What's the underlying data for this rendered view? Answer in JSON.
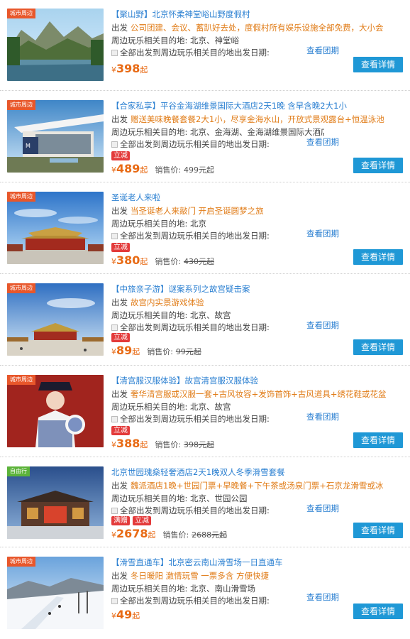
{
  "items": [
    {
      "badge": "城市周边",
      "title": "【聚山野】北京怀柔神堂峪山野度假村",
      "line2_label": "出发",
      "line2_text": "公司团建、会议、蓄趴好去处，度假村所有娱乐设施全部免费，大小会",
      "destinations": "周边玩乐相关目的地: 北京、神堂峪",
      "departure": "全部出发到周边玩乐相关目的地出发日期:",
      "view_group": "查看团期",
      "tags": [],
      "price": "398",
      "yen": "¥",
      "qi": "起",
      "orig_label": "",
      "orig_price": "",
      "detail_button": "查看详情"
    },
    {
      "badge": "城市周边",
      "title": "【合家私享】平谷金海湖维景国际大酒店2天1晚 含早含晚2大1小",
      "line2_label": "出发",
      "line2_text": "赠送美味晚餐套餐2大1小，尽享金海水山，开放式景观露台+恒温泳池",
      "destinations": "周边玩乐相关目的地: 北京、金海湖、金海湖维景国际大酒店",
      "departure": "全部出发到周边玩乐相关目的地出发日期:",
      "view_group": "查看团期",
      "tags": [
        "立减"
      ],
      "price": "489",
      "yen": "¥",
      "qi": "起",
      "orig_label": "销售价:",
      "orig_price": "499元起",
      "detail_button": "查看详情"
    },
    {
      "badge": "城市周边",
      "title": "圣诞老人来啦",
      "line2_label": "出发",
      "line2_text": "当圣诞老人来敲门 开启圣诞圆梦之旅",
      "destinations": "周边玩乐相关目的地: 北京",
      "departure": "全部出发到周边玩乐相关目的地出发日期:",
      "view_group": "查看团期",
      "tags": [
        "立减"
      ],
      "price": "380",
      "yen": "¥",
      "qi": "起",
      "orig_label": "销售价:",
      "orig_price": "430元起",
      "detail_button": "查看详情"
    },
    {
      "badge": "城市周边",
      "title": "【中旅亲子游】谜案系列之故宫疑击案",
      "line2_label": "出发",
      "line2_text": "故宫内实景游戏体验",
      "destinations": "周边玩乐相关目的地: 北京、故宫",
      "departure": "全部出发到周边玩乐相关目的地出发日期:",
      "view_group": "查看团期",
      "tags": [
        "立减"
      ],
      "price": "89",
      "yen": "¥",
      "qi": "起",
      "orig_label": "销售价:",
      "orig_price": "99元起",
      "detail_button": "查看详情"
    },
    {
      "badge": "城市周边",
      "title": "【清宫服汉服体验】故宫清宫服汉服体验",
      "line2_label": "出发",
      "line2_text": "奢华清宫服或汉服一套+古风妆容+发饰首饰+古风道具+绣花鞋或花盆",
      "destinations": "周边玩乐相关目的地: 北京、故宫",
      "departure": "全部出发到周边玩乐相关目的地出发日期:",
      "view_group": "查看团期",
      "tags": [
        "立减"
      ],
      "price": "388",
      "yen": "¥",
      "qi": "起",
      "orig_label": "销售价:",
      "orig_price": "398元起",
      "detail_button": "查看详情"
    },
    {
      "badge": "自由行",
      "title": "北京世园瑰燊轻奢酒店2天1晚双人冬季滑雪套餐",
      "line2_label": "出发",
      "line2_text": "魏派酒店1晚+世园门票+早晚餐+下午茶或汤泉门票+石京龙滑雪或冰",
      "destinations": "周边玩乐相关目的地: 北京、世园公园",
      "departure": "全部出发到周边玩乐相关目的地出发日期:",
      "view_group": "查看团期",
      "tags": [
        "满赠",
        "立减"
      ],
      "price": "2678",
      "yen": "¥",
      "qi": "起",
      "orig_label": "销售价:",
      "orig_price": "2688元起",
      "detail_button": "查看详情"
    },
    {
      "badge": "城市周边",
      "title": "【滑雪直通车】北京密云南山滑雪场一日直通车",
      "line2_label": "出发",
      "line2_text": "冬日暖阳 激情玩雪 一票多含 方便快捷",
      "destinations": "周边玩乐相关目的地: 北京、南山滑雪场",
      "departure": "全部出发到周边玩乐相关目的地出发日期:",
      "view_group": "查看团期",
      "tags": [],
      "price": "49",
      "yen": "¥",
      "qi": "起",
      "orig_label": "",
      "orig_price": "",
      "detail_button": "查看详情"
    }
  ],
  "colors": {
    "title_blue": "#2a7fd1",
    "orange_text": "#e07b16",
    "price_orange": "#e86a14",
    "tag_red": "#e33a3a",
    "button_blue": "#1f98d6",
    "badge_orange": "#e8572b",
    "badge_green": "#5cb33a"
  }
}
